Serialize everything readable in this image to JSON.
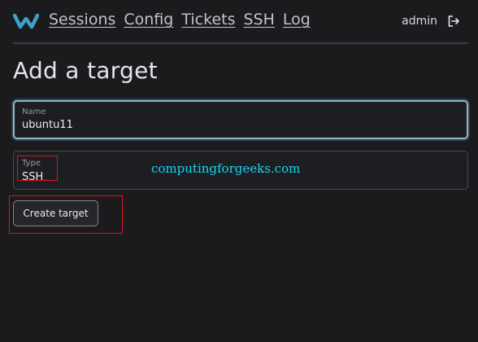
{
  "app": {
    "logo_icon": "warpgate-w-logo",
    "accent_color": "#3ba3c9"
  },
  "nav": {
    "items": [
      {
        "label": "Sessions"
      },
      {
        "label": "Config"
      },
      {
        "label": "Tickets"
      },
      {
        "label": "SSH"
      },
      {
        "label": "Log"
      }
    ]
  },
  "user": {
    "name": "admin",
    "logout_icon": "logout-icon"
  },
  "page": {
    "title": "Add a target"
  },
  "form": {
    "name": {
      "label": "Name",
      "value": "ubuntu11"
    },
    "type": {
      "label": "Type",
      "value": "SSH"
    },
    "submit_label": "Create target"
  },
  "watermark": "computingforgeeks.com",
  "annotation_color": "#e0141f"
}
